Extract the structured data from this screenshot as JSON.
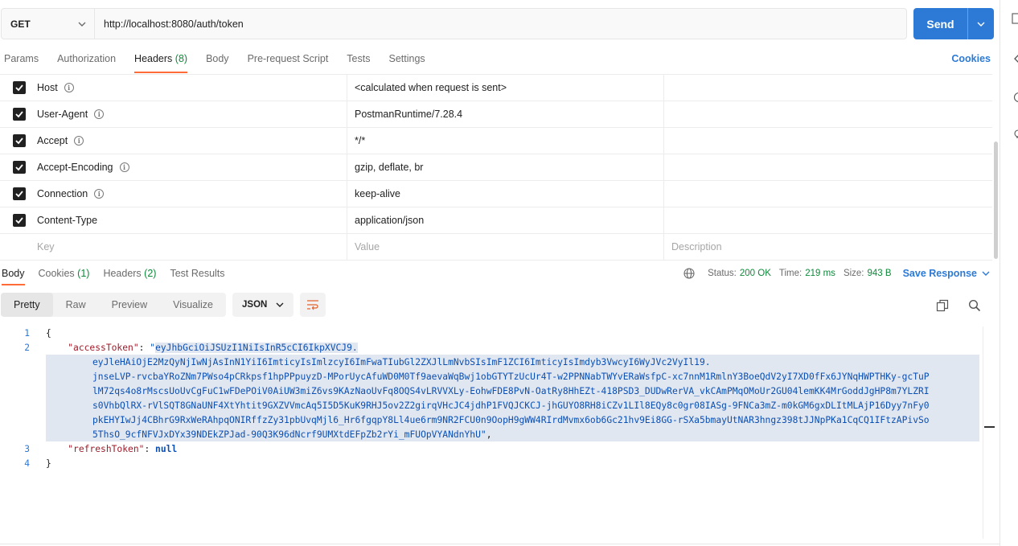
{
  "request": {
    "method": "GET",
    "url": "http://localhost:8080/auth/token",
    "send_label": "Send"
  },
  "request_tabs": [
    {
      "label": "Params",
      "count": ""
    },
    {
      "label": "Authorization",
      "count": ""
    },
    {
      "label": "Headers",
      "count": "(8)"
    },
    {
      "label": "Body",
      "count": ""
    },
    {
      "label": "Pre-request Script",
      "count": ""
    },
    {
      "label": "Tests",
      "count": ""
    },
    {
      "label": "Settings",
      "count": ""
    }
  ],
  "cookies_link": "Cookies",
  "headers": [
    {
      "key": "Host",
      "value": "<calculated when request is sent>"
    },
    {
      "key": "User-Agent",
      "value": "PostmanRuntime/7.28.4"
    },
    {
      "key": "Accept",
      "value": "*/*"
    },
    {
      "key": "Accept-Encoding",
      "value": "gzip, deflate, br"
    },
    {
      "key": "Connection",
      "value": "keep-alive"
    },
    {
      "key": "Content-Type",
      "value": "application/json"
    }
  ],
  "headers_placeholder": {
    "key": "Key",
    "value": "Value",
    "description": "Description"
  },
  "response_tabs": [
    {
      "label": "Body",
      "count": ""
    },
    {
      "label": "Cookies",
      "count": "(1)"
    },
    {
      "label": "Headers",
      "count": "(2)"
    },
    {
      "label": "Test Results",
      "count": ""
    }
  ],
  "response_status": {
    "status_label": "Status:",
    "status_value": "200 OK",
    "time_label": "Time:",
    "time_value": "219 ms",
    "size_label": "Size:",
    "size_value": "943 B",
    "save_label": "Save Response"
  },
  "view_modes": [
    "Pretty",
    "Raw",
    "Preview",
    "Visualize"
  ],
  "format": "JSON",
  "code_lines": {
    "numbers": [
      "1",
      "2",
      "3",
      "4"
    ],
    "open": "{",
    "close": "}",
    "access_key": "\"accessToken\"",
    "refresh_key": "\"refreshToken\"",
    "refresh_value": "null",
    "token_lines": [
      "eyJhbGciOiJSUzI1NiIsInR5cCI6IkpXVCJ9.",
      "eyJleHAiOjE2MzQyNjIwNjAsInN1YiI6ImticyIsImlzcyI6ImFwaTIubGl2ZXJlLmNvbSIsImF1ZCI6ImticyIsImdyb3VwcyI6WyJVc2VyIl19.",
      "jnseLVP-rvcbaYRoZNm7PWso4pCRkpsf1hpPPpuyzD-MPorUycAfuWD0M0Tf9aevaWqBwj1obGTYTzUcUr4T-w2PPNNabTWYvERaWsfpC-xc7nnM1RmlnY3BoeQdV2yI7XD0fFx6JYNqHWPTHKy-gcTuP",
      "lM72qs4o8rMscsUoUvCgFuC1wFDePOiV0AiUW3miZ6vs9KAzNaoUvFq8OQS4vLRVVXLy-EohwFDE8PvN-OatRy8HhEZt-418PSD3_DUDwRerVA_vkCAmPMqOMoUr2GU04lemKK4MrGoddJgHP8m7YLZRI",
      "s0VhbQlRX-rVlSQT8GNaUNF4XtYhtit9GXZVVmcAq5I5D5KuK9RHJ5ov2Z2girqVHcJC4jdhP1FVQJCKCJ-jhGUYO8RH8iCZv1LIl8EQy8c0gr08IASg-9FNCa3mZ-m0kGM6gxDLItMLAjP16Dyy7nFy0",
      "pkEHYIwJj4CBhrG9RxWeRAhpqONIRffzZy31pbUvqMjl6_Hr6fgqpY8Ll4ue6rm9NR2FCU0n9OopH9gWW4RIrdMvmx6ob6Gc21hv9Ei8GG-rSXa5bmayUtNAR3hngz398tJJNpPKa1CqCQ1IFtzAPivSo",
      "5ThsO_9cfNFVJxDYx39NDEkZPJad-90Q3K96dNcrf9UMXtdEFpZb2rYi_mFUOpVYANdnYhU"
    ]
  }
}
